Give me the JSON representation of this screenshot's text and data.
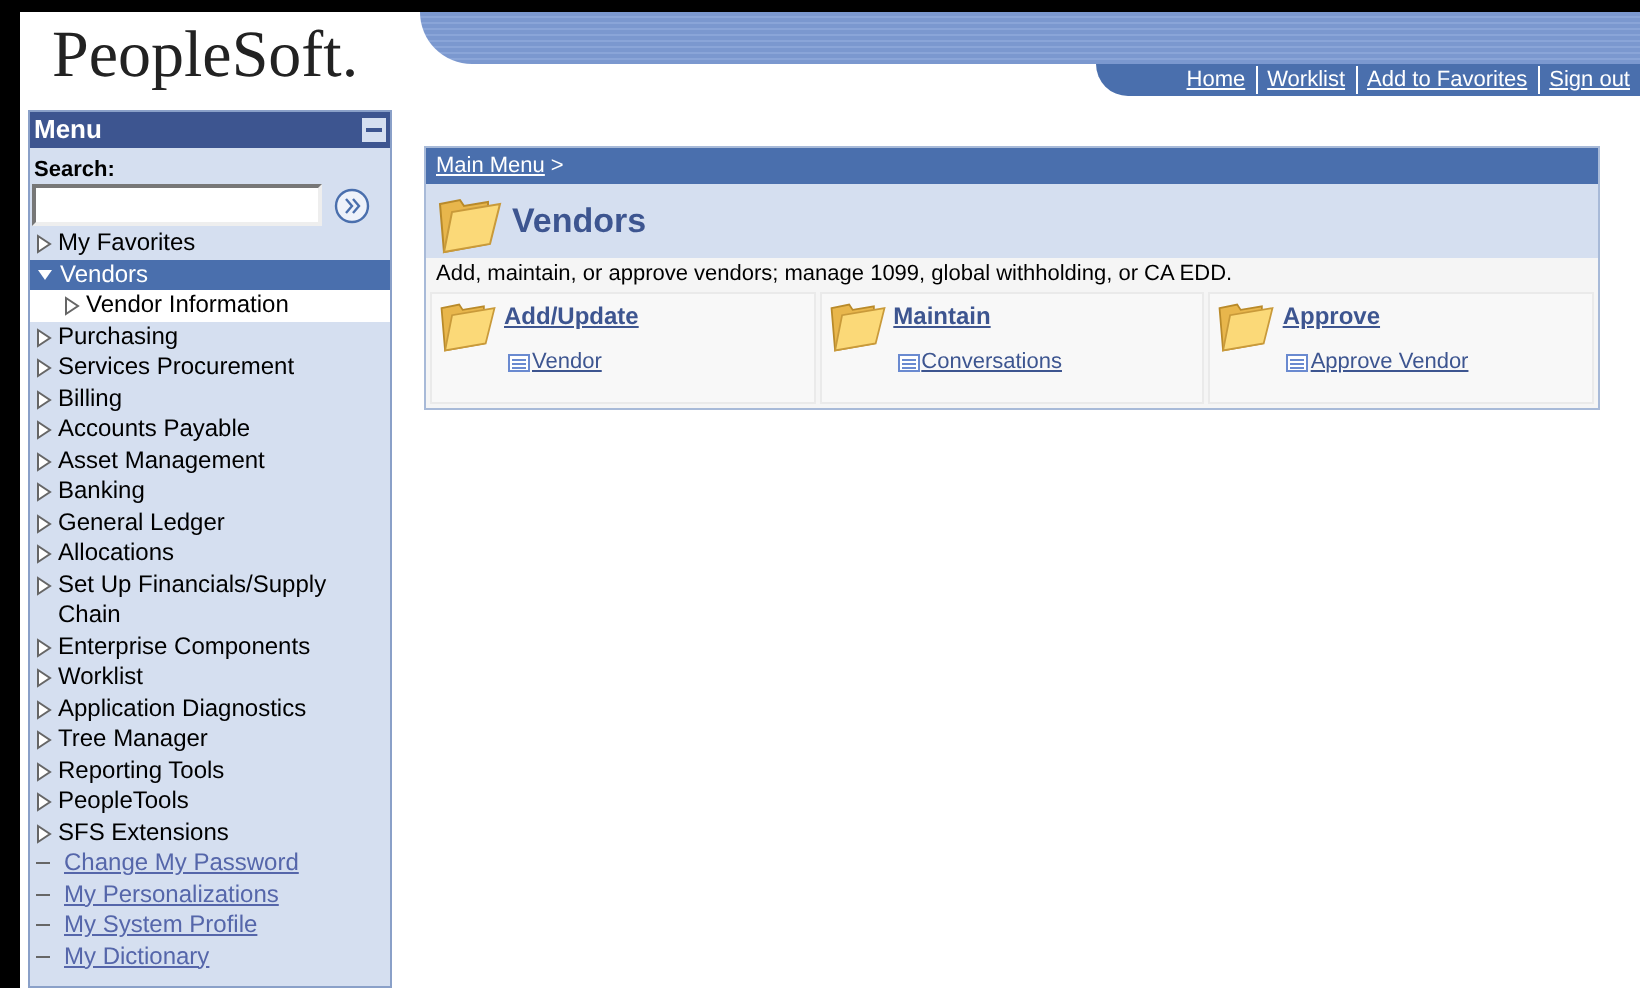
{
  "logo": "PeopleSoft.",
  "nav_links": [
    "Home",
    "Worklist",
    "Add to Favorites",
    "Sign out"
  ],
  "menu": {
    "title": "Menu",
    "search_label": "Search:",
    "items": [
      {
        "kind": "folder",
        "label": "My Favorites",
        "expanded": false,
        "selected": false
      },
      {
        "kind": "folder",
        "label": "Vendors",
        "expanded": true,
        "selected": true,
        "children": [
          {
            "kind": "folder",
            "label": "Vendor Information",
            "expanded": false,
            "selected": false
          }
        ]
      },
      {
        "kind": "folder",
        "label": "Purchasing",
        "expanded": false,
        "selected": false
      },
      {
        "kind": "folder",
        "label": "Services Procurement",
        "expanded": false,
        "selected": false
      },
      {
        "kind": "folder",
        "label": "Billing",
        "expanded": false,
        "selected": false
      },
      {
        "kind": "folder",
        "label": "Accounts Payable",
        "expanded": false,
        "selected": false
      },
      {
        "kind": "folder",
        "label": "Asset Management",
        "expanded": false,
        "selected": false
      },
      {
        "kind": "folder",
        "label": "Banking",
        "expanded": false,
        "selected": false
      },
      {
        "kind": "folder",
        "label": "General Ledger",
        "expanded": false,
        "selected": false
      },
      {
        "kind": "folder",
        "label": "Allocations",
        "expanded": false,
        "selected": false
      },
      {
        "kind": "folder",
        "label": "Set Up Financials/Supply Chain",
        "expanded": false,
        "selected": false
      },
      {
        "kind": "folder",
        "label": "Enterprise Components",
        "expanded": false,
        "selected": false
      },
      {
        "kind": "folder",
        "label": "Worklist",
        "expanded": false,
        "selected": false
      },
      {
        "kind": "folder",
        "label": "Application Diagnostics",
        "expanded": false,
        "selected": false
      },
      {
        "kind": "folder",
        "label": "Tree Manager",
        "expanded": false,
        "selected": false
      },
      {
        "kind": "folder",
        "label": "Reporting Tools",
        "expanded": false,
        "selected": false
      },
      {
        "kind": "folder",
        "label": "PeopleTools",
        "expanded": false,
        "selected": false
      },
      {
        "kind": "folder",
        "label": "SFS Extensions",
        "expanded": false,
        "selected": false
      },
      {
        "kind": "link",
        "label": "Change My Password",
        "expanded": false,
        "selected": false
      },
      {
        "kind": "link",
        "label": "My Personalizations",
        "expanded": false,
        "selected": false
      },
      {
        "kind": "link",
        "label": "My System Profile",
        "expanded": false,
        "selected": false
      },
      {
        "kind": "link",
        "label": "My Dictionary",
        "expanded": false,
        "selected": false
      }
    ]
  },
  "content": {
    "breadcrumb": "Main Menu",
    "breadcrumb_sep": ">",
    "title": "Vendors",
    "description": "Add, maintain, or approve vendors; manage 1099, global withholding, or CA EDD.",
    "categories": [
      {
        "title": "Add/Update",
        "link": "Vendor"
      },
      {
        "title": "Maintain",
        "link": "Conversations"
      },
      {
        "title": "Approve",
        "link": "Approve Vendor"
      }
    ]
  }
}
